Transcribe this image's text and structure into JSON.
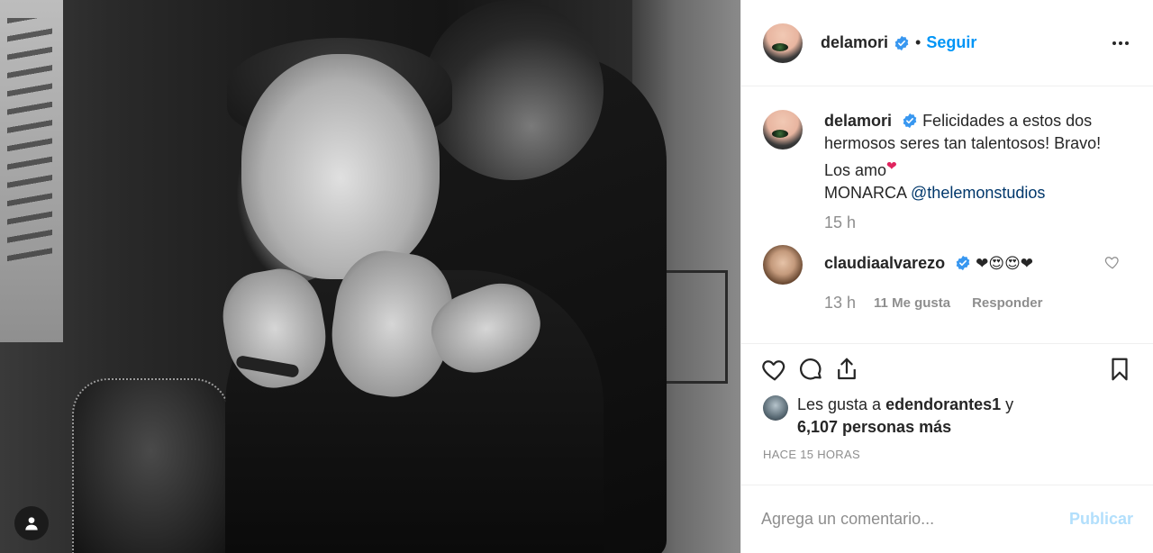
{
  "post": {
    "author": "delamori",
    "follow_label": "Seguir",
    "separator": "•",
    "more_icon": "more-horizontal-icon"
  },
  "caption": {
    "username": "delamori",
    "text": "Felicidades a estos dos hermosos seres tan talentosos! Bravo! Los amo",
    "heart_emoji": "❤",
    "line2_prefix": "MONARCA",
    "mention": "@thelemonstudios",
    "time": "15 h"
  },
  "comment": {
    "username": "claudiaalvarezo",
    "emojis": "❤😍😍❤",
    "time": "13 h",
    "likes": "11 Me gusta",
    "reply": "Responder"
  },
  "actions": {
    "like_icon": "heart-outline-icon",
    "comment_icon": "comment-bubble-icon",
    "share_icon": "share-upload-icon",
    "save_icon": "bookmark-icon"
  },
  "likes": {
    "prefix": "Les gusta a",
    "user": "edendorantes1",
    "conj": "y",
    "others": "6,107 personas más"
  },
  "timestamp": "HACE 15 HORAS",
  "add_comment": {
    "placeholder": "Agrega un comentario...",
    "publish_label": "Publicar"
  },
  "colors": {
    "accent": "#0095f6",
    "publish_disabled": "#b2dffc",
    "muted": "#8e8e8e",
    "text": "#262626"
  }
}
